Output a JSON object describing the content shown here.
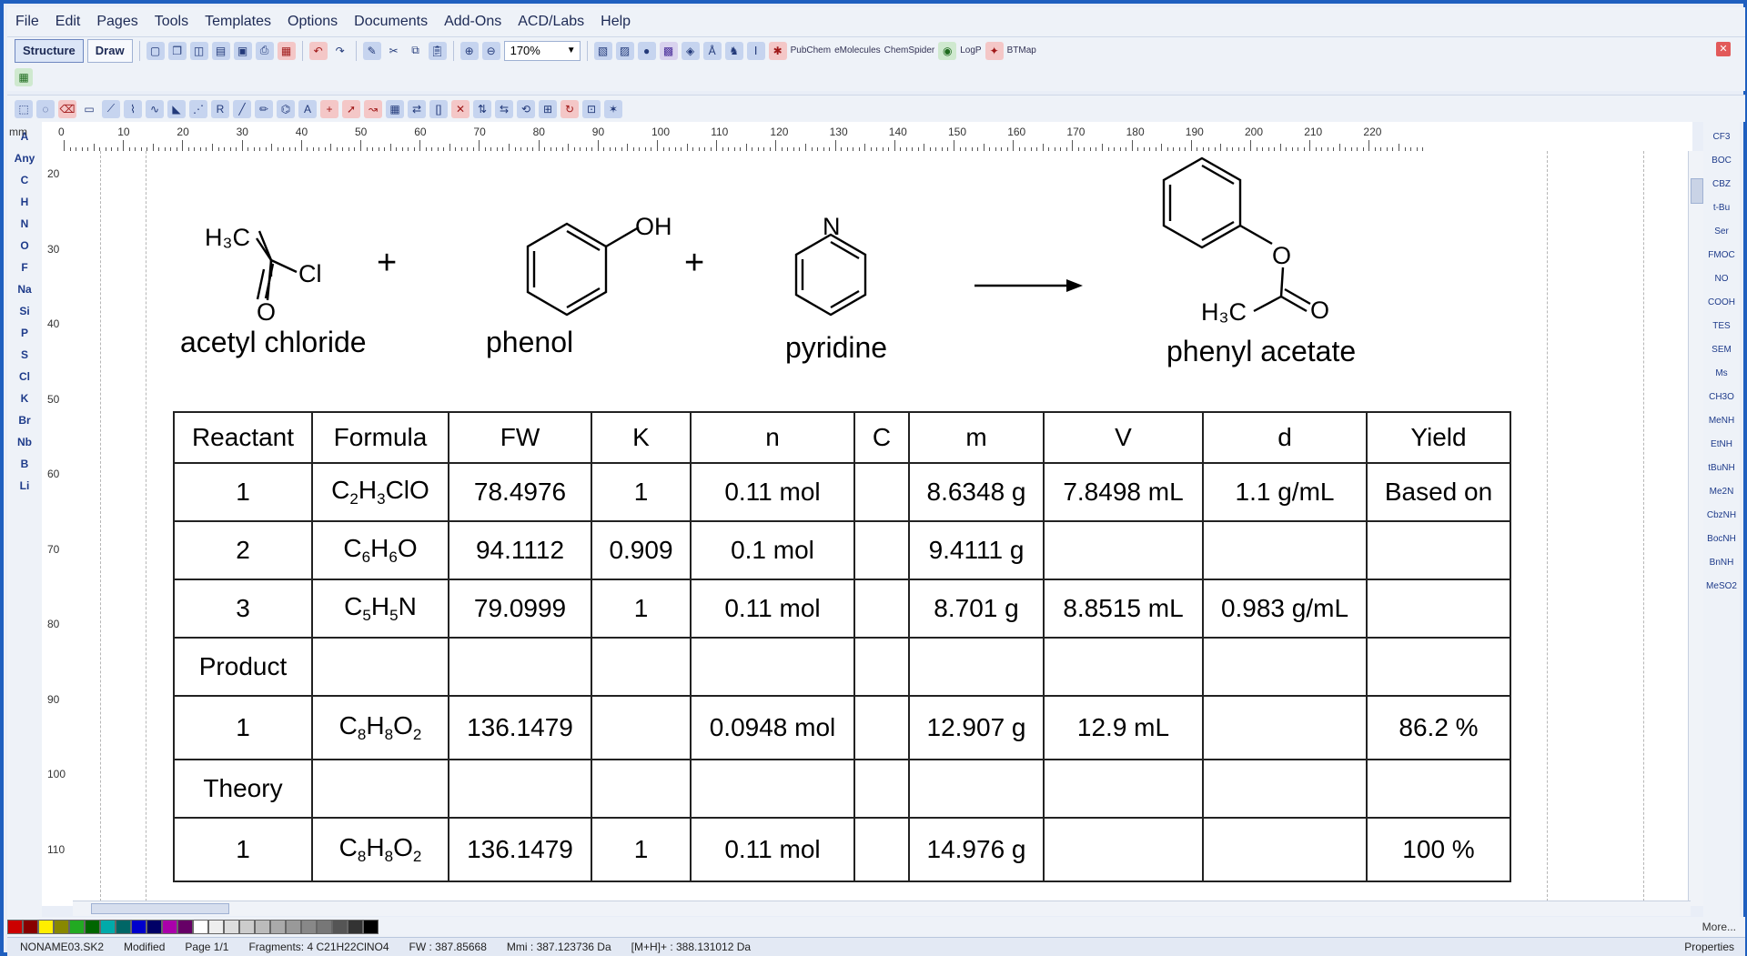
{
  "menu": {
    "items": [
      "File",
      "Edit",
      "Pages",
      "Tools",
      "Templates",
      "Options",
      "Documents",
      "Add-Ons",
      "ACD/Labs",
      "Help"
    ]
  },
  "toolbar": {
    "structure_label": "Structure",
    "draw_label": "Draw",
    "zoom_value": "170%",
    "pubchem_label": "PubChem",
    "emolecules_label": "eMolecules",
    "chemspider_label": "ChemSpider",
    "logp_label": "LogP",
    "btmap_label": "BTMap",
    "icons": [
      "new-page-icon",
      "copy-page-icon",
      "open-icon",
      "save-icon",
      "print-icon",
      "undo-icon",
      "redo-icon",
      "cut-icon",
      "copy-icon",
      "paste-icon",
      "zoom-in-icon",
      "zoom-out-icon"
    ]
  },
  "ruler": {
    "unit": "mm",
    "h_labels": [
      "0",
      "10",
      "20",
      "30",
      "40",
      "50",
      "60",
      "70",
      "80",
      "90",
      "100",
      "110",
      "120",
      "130",
      "140",
      "150",
      "160",
      "170",
      "180",
      "190",
      "200",
      "210",
      "220"
    ],
    "v_labels": [
      "20",
      "30",
      "40",
      "50",
      "60",
      "70",
      "80",
      "90",
      "100",
      "110"
    ]
  },
  "left_atoms": [
    "A",
    "Any",
    "C",
    "H",
    "N",
    "O",
    "F",
    "Na",
    "Si",
    "P",
    "S",
    "Cl",
    "K",
    "Br",
    "Nb",
    "B",
    "Li"
  ],
  "right_groups": [
    "CF3",
    "BOC",
    "CBZ",
    "t-Bu",
    "Ser",
    "FMOC",
    "NO",
    "COOH",
    "TES",
    "SEM",
    "Ms",
    "CH3O",
    "MeNH",
    "EtNH",
    "tBuNH",
    "Me2N",
    "CbzNH",
    "BocNH",
    "BnNH",
    "MeSO2"
  ],
  "reaction": {
    "reactant1_name": "acetyl chloride",
    "reactant2_name": "phenol",
    "reagent_name": "pyridine",
    "product_name": "phenyl acetate",
    "plus1": "+",
    "plus2": "+",
    "atoms": {
      "h3c_1": "H₃C",
      "cl": "Cl",
      "o_1": "O",
      "oh": "OH",
      "n": "N",
      "o_2": "O",
      "o_3": "O",
      "h3c_2": "H₃C"
    }
  },
  "table": {
    "headers": [
      "Reactant",
      "Formula",
      "FW",
      "K",
      "n",
      "C",
      "m",
      "V",
      "d",
      "Yield"
    ],
    "rows": [
      [
        "1",
        "C2H3ClO",
        "78.4976",
        "1",
        "0.11 mol",
        "",
        "8.6348 g",
        "7.8498 mL",
        "1.1 g/mL",
        "Based on"
      ],
      [
        "2",
        "C6H6O",
        "94.1112",
        "0.909",
        "0.1 mol",
        "",
        "9.4111 g",
        "",
        "",
        ""
      ],
      [
        "3",
        "C5H5N",
        "79.0999",
        "1",
        "0.11 mol",
        "",
        "8.701 g",
        "8.8515 mL",
        "0.983 g/mL",
        ""
      ],
      [
        "Product",
        "",
        "",
        "",
        "",
        "",
        "",
        "",
        "",
        ""
      ],
      [
        "1",
        "C8H8O2",
        "136.1479",
        "",
        "0.0948 mol",
        "",
        "12.907 g",
        "12.9 mL",
        "",
        "86.2 %"
      ],
      [
        "Theory",
        "",
        "",
        "",
        "",
        "",
        "",
        "",
        "",
        ""
      ],
      [
        "1",
        "C8H8O2",
        "136.1479",
        "1",
        "0.11 mol",
        "",
        "14.976 g",
        "",
        "",
        "100 %"
      ]
    ]
  },
  "palette": {
    "colors": [
      "#cc0000",
      "#880000",
      "#ffee00",
      "#888800",
      "#22aa22",
      "#006600",
      "#00aaaa",
      "#006666",
      "#0000cc",
      "#000066",
      "#aa00aa",
      "#660066",
      "#ffffff",
      "#eeeeee",
      "#dddddd",
      "#cccccc",
      "#bbbbbb",
      "#aaaaaa",
      "#999999",
      "#888888",
      "#777777",
      "#555555",
      "#333333",
      "#000000"
    ],
    "more_label": "More..."
  },
  "status": {
    "filename": "NONAME03.SK2",
    "modified": "Modified",
    "page": "Page 1/1",
    "fragments": "Fragments: 4  C21H22ClNO4",
    "fw": "FW : 387.85668",
    "mmi": "Mmi : 387.123736 Da",
    "mh": "[M+H]+ : 388.131012 Da",
    "properties": "Properties"
  }
}
